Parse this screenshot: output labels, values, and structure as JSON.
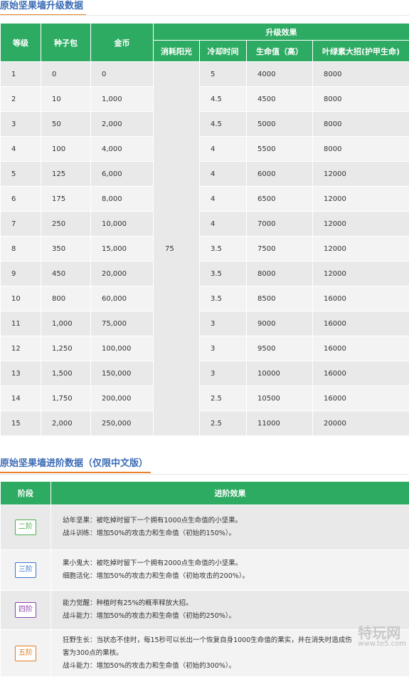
{
  "section1": {
    "title": "原始坚果墙升级数据",
    "headers": {
      "level": "等级",
      "seeds": "种子包",
      "gold": "金币",
      "effect_group": "升级效果",
      "sun": "消耗阳光",
      "cooldown": "冷却时间",
      "hp": "生命值（高）",
      "ultimate": "叶绿素大招(护甲生命)"
    },
    "sun_cost": "75",
    "rows": [
      {
        "level": "1",
        "seeds": "0",
        "gold": "0",
        "cooldown": "5",
        "hp": "4000",
        "ult": "8000"
      },
      {
        "level": "2",
        "seeds": "10",
        "gold": "1,000",
        "cooldown": "4.5",
        "hp": "4500",
        "ult": "8000"
      },
      {
        "level": "3",
        "seeds": "50",
        "gold": "2,000",
        "cooldown": "4.5",
        "hp": "5000",
        "ult": "8000"
      },
      {
        "level": "4",
        "seeds": "100",
        "gold": "4,000",
        "cooldown": "4",
        "hp": "5500",
        "ult": "8000"
      },
      {
        "level": "5",
        "seeds": "125",
        "gold": "6,000",
        "cooldown": "4",
        "hp": "6000",
        "ult": "12000"
      },
      {
        "level": "6",
        "seeds": "175",
        "gold": "8,000",
        "cooldown": "4",
        "hp": "6500",
        "ult": "12000"
      },
      {
        "level": "7",
        "seeds": "250",
        "gold": "10,000",
        "cooldown": "4",
        "hp": "7000",
        "ult": "12000"
      },
      {
        "level": "8",
        "seeds": "350",
        "gold": "15,000",
        "cooldown": "3.5",
        "hp": "7500",
        "ult": "12000"
      },
      {
        "level": "9",
        "seeds": "450",
        "gold": "20,000",
        "cooldown": "3.5",
        "hp": "8000",
        "ult": "12000"
      },
      {
        "level": "10",
        "seeds": "800",
        "gold": "60,000",
        "cooldown": "3.5",
        "hp": "8500",
        "ult": "16000"
      },
      {
        "level": "11",
        "seeds": "1,000",
        "gold": "75,000",
        "cooldown": "3",
        "hp": "9000",
        "ult": "16000"
      },
      {
        "level": "12",
        "seeds": "1,250",
        "gold": "100,000",
        "cooldown": "3",
        "hp": "9500",
        "ult": "16000"
      },
      {
        "level": "13",
        "seeds": "1,500",
        "gold": "150,000",
        "cooldown": "3",
        "hp": "10000",
        "ult": "16000"
      },
      {
        "level": "14",
        "seeds": "1,750",
        "gold": "200,000",
        "cooldown": "2.5",
        "hp": "10500",
        "ult": "16000"
      },
      {
        "level": "15",
        "seeds": "2,000",
        "gold": "250,000",
        "cooldown": "2.5",
        "hp": "11000",
        "ult": "20000"
      }
    ]
  },
  "section2": {
    "title": "原始坚果墙进阶数据（仅限中文版）",
    "headers": {
      "stage": "阶段",
      "effect": "进阶效果"
    },
    "rows": [
      {
        "stage": "二阶",
        "color": "#4caf50",
        "lines": [
          "幼年坚果：被吃掉时留下一个拥有1000点生命值的小坚果。",
          "战斗训练：增加50%的攻击力和生命值（初始的150%）。"
        ]
      },
      {
        "stage": "三阶",
        "color": "#3a78c9",
        "lines": [
          "果小鬼大：被吃掉时留下一个拥有2000点生命值的小坚果。",
          "细胞活化：增加50%的攻击力和生命值（初始攻击的200%）。"
        ]
      },
      {
        "stage": "四阶",
        "color": "#8e44ad",
        "lines": [
          "能力觉醒：种植时有25%的概率释放大招。",
          "战斗能力：增加50%的攻击力和生命值（初始的250%）。"
        ]
      },
      {
        "stage": "五阶",
        "color": "#e07b1f",
        "lines": [
          "狂野生长：当状态不佳时，每15秒可以长出一个恢复自身1000生命值的果实，并在消失时造成伤",
          "害为300点的果核。",
          "战斗能力：增加50%的攻击力和生命值（初始的300%）。"
        ]
      }
    ]
  },
  "watermark": {
    "brand": "特玩网",
    "url": "www.te5.com"
  }
}
